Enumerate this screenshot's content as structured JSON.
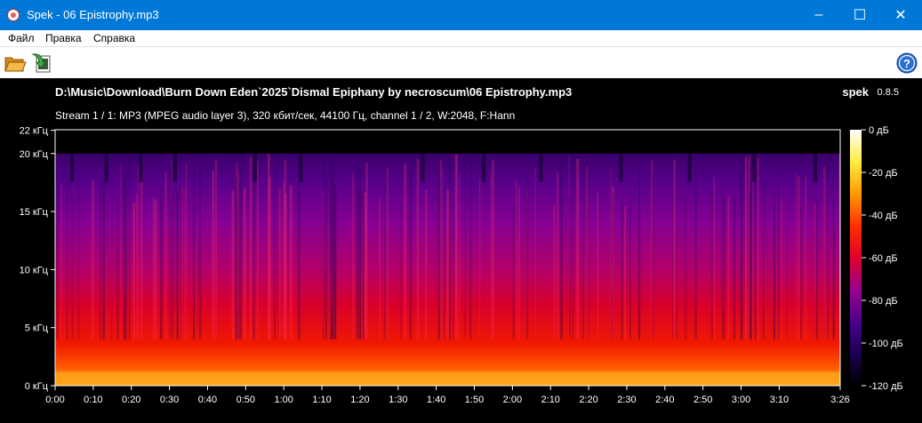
{
  "window": {
    "title": "Spek - 06 Epistrophy.mp3"
  },
  "window_controls": {
    "minimize": "–",
    "maximize": "☐",
    "close": "✕"
  },
  "menu": {
    "items": [
      {
        "label": "Файл"
      },
      {
        "label": "Правка"
      },
      {
        "label": "Справка"
      }
    ]
  },
  "toolbar": {
    "icons": [
      "open-folder-icon",
      "save-image-icon",
      "help-icon"
    ]
  },
  "viewer": {
    "file_path": "D:\\Music\\Download\\Burn Down Eden`2025`Dismal Epiphany by necroscum\\06 Epistrophy.mp3",
    "app_name": "spek",
    "app_version": "0.8.5",
    "stream_info": "Stream 1 / 1: MP3 (MPEG audio layer 3), 320 кбит/сек, 44100 Гц, channel 1 / 2, W:2048, F:Hann"
  },
  "chart_data": {
    "type": "heatmap",
    "title": "",
    "xlabel": "",
    "ylabel": "",
    "x_ticks": [
      "0:00",
      "0:10",
      "0:20",
      "0:30",
      "0:40",
      "0:50",
      "1:00",
      "1:10",
      "1:20",
      "1:30",
      "1:40",
      "1:50",
      "2:00",
      "2:10",
      "2:20",
      "2:30",
      "2:40",
      "2:50",
      "3:00",
      "3:10",
      "3:26"
    ],
    "x_tick_seconds": [
      0,
      10,
      20,
      30,
      40,
      50,
      60,
      70,
      80,
      90,
      100,
      110,
      120,
      130,
      140,
      150,
      160,
      170,
      180,
      190,
      206
    ],
    "xlim": [
      0,
      206
    ],
    "y_ticks": [
      "0 кГц",
      "5 кГц",
      "10 кГц",
      "15 кГц",
      "20 кГц",
      "22 кГц"
    ],
    "y_tick_khz": [
      0,
      5,
      10,
      15,
      20,
      22
    ],
    "ylim": [
      0,
      22.05
    ],
    "lowpass_cutoff_khz": 20,
    "colorbar_ticks": [
      "0 дБ",
      "-20 дБ",
      "-40 дБ",
      "-60 дБ",
      "-80 дБ",
      "-100 дБ",
      "-120 дБ"
    ],
    "colorbar_db": [
      0,
      -20,
      -40,
      -60,
      -80,
      -100,
      -120
    ],
    "color_range_db": [
      -120,
      0
    ],
    "colormap": [
      "#000000",
      "#1a0050",
      "#4b008c",
      "#9a0090",
      "#e0002a",
      "#ff3000",
      "#ff9900",
      "#ffee40",
      "#ffffff"
    ],
    "grid": false
  }
}
